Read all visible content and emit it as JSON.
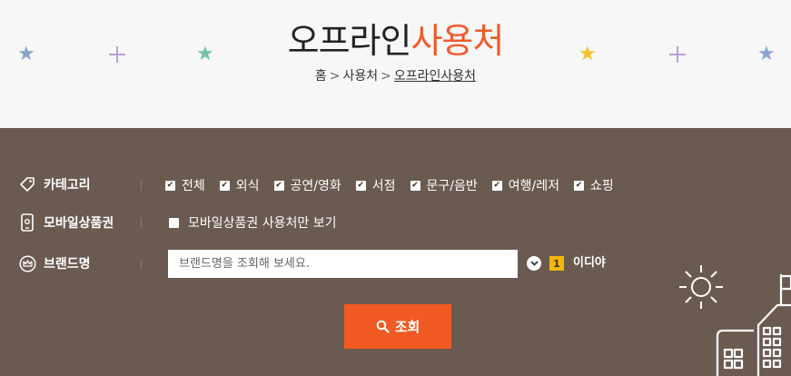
{
  "header": {
    "title_main": "오프라인",
    "title_accent": "사용처",
    "breadcrumb": [
      "홈",
      "사용처",
      "오프라인사용처"
    ],
    "breadcrumb_sep": ">"
  },
  "colors": {
    "accent": "#ef5a2a",
    "panel_bg": "#6a5a50",
    "button_bg": "#f15a22",
    "badge": "#f5b800"
  },
  "filters": {
    "category_label": "카테고리",
    "categories": [
      {
        "label": "전체",
        "checked": true
      },
      {
        "label": "외식",
        "checked": true
      },
      {
        "label": "공연/영화",
        "checked": true
      },
      {
        "label": "서점",
        "checked": true
      },
      {
        "label": "문구/음반",
        "checked": true
      },
      {
        "label": "여행/레저",
        "checked": true
      },
      {
        "label": "쇼핑",
        "checked": true
      }
    ],
    "mobile_label": "모바일상품권",
    "mobile_option": "모바일상품권 사용처만 보기",
    "brand_label": "브랜드명",
    "brand_placeholder": "브랜드명을 조회해 보세요.",
    "selected_count": "1",
    "selected_brand": "이디야"
  },
  "search_button": "조회",
  "icons": [
    "tag-icon",
    "mobile-icon",
    "crown-icon",
    "check-icon",
    "chevron-down-icon",
    "search-icon",
    "star-icon",
    "plus-icon",
    "sun-icon",
    "building-icon"
  ]
}
